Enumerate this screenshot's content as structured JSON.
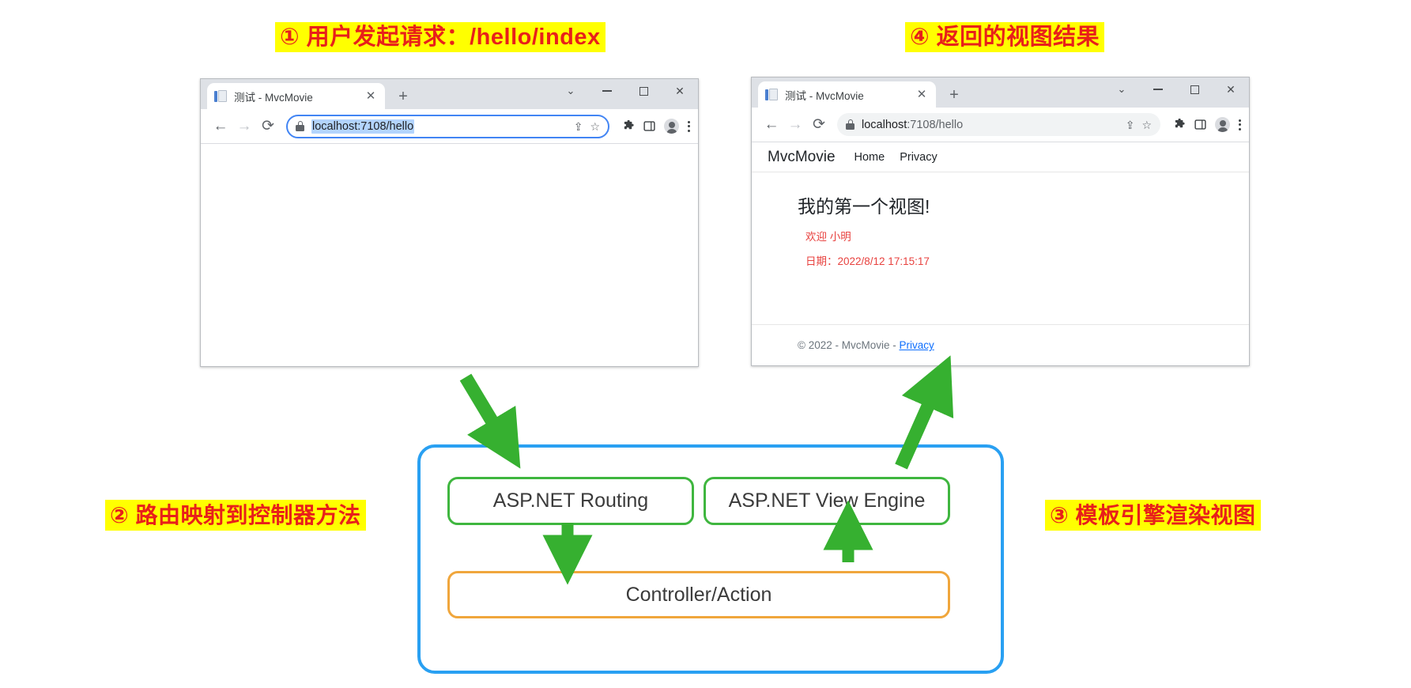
{
  "annotations": [
    {
      "id": "step1",
      "text": "① 用户发起请求：/hello/index"
    },
    {
      "id": "step2",
      "text": "② 路由映射到控制器方法"
    },
    {
      "id": "step3",
      "text": "③ 模板引擎渲染视图"
    },
    {
      "id": "step4",
      "text": "④ 返回的视图结果"
    }
  ],
  "colors": {
    "highlight_bg": "#ffff00",
    "annotation_text": "#e8201a",
    "container_border": "#29a0f2",
    "green_border": "#3fb63f",
    "orange_border": "#f0a63c",
    "arrow_green": "#36b030",
    "page_red": "#e8423f",
    "link_blue": "#0d6efd"
  },
  "browser_left": {
    "tab": {
      "title": "测试 - MvcMovie",
      "close_label": "✕",
      "favicon": "document-icon"
    },
    "new_tab_label": "+",
    "window_controls": {
      "collapse": "⌄",
      "minimize": "—",
      "maximize": "▢",
      "close": "✕"
    },
    "toolbar": {
      "back": "←",
      "forward": "→",
      "reload": "⟳",
      "share": "⇪",
      "bookmark": "☆",
      "extensions": "🧩",
      "sidepanel": "▯",
      "profile": "profile-avatar",
      "menu": "⋮"
    },
    "omnibox": {
      "url_full": "localhost:7108/hello",
      "url_host": "localhost",
      "url_path": ":7108/hello",
      "selected": true,
      "placeholder": "Search Google or type a URL"
    },
    "page": {
      "content": ""
    }
  },
  "browser_right": {
    "tab": {
      "title": "测试 - MvcMovie",
      "close_label": "✕",
      "favicon": "document-icon"
    },
    "new_tab_label": "+",
    "window_controls": {
      "collapse": "⌄",
      "minimize": "—",
      "maximize": "▢",
      "close": "✕"
    },
    "toolbar": {
      "back": "←",
      "forward": "→",
      "reload": "⟳",
      "share": "⇪",
      "bookmark": "☆",
      "extensions": "🧩",
      "sidepanel": "▯",
      "profile": "profile-avatar",
      "menu": "⋮"
    },
    "omnibox": {
      "url_full": "localhost:7108/hello",
      "url_host": "localhost",
      "url_path": ":7108/hello",
      "selected": false,
      "placeholder": "Search Google or type a URL"
    },
    "page": {
      "brand": "MvcMovie",
      "nav": [
        {
          "label": "Home"
        },
        {
          "label": "Privacy"
        }
      ],
      "heading": "我的第一个视图!",
      "welcome": "欢迎 小明",
      "date_line": "日期：2022/8/12 17:15:17",
      "footer": {
        "text": "© 2022 - MvcMovie - ",
        "link": "Privacy"
      }
    }
  },
  "diagram": {
    "boxes": [
      {
        "id": "routing",
        "label": "ASP.NET Routing"
      },
      {
        "id": "view_engine",
        "label": "ASP.NET View Engine"
      },
      {
        "id": "controller",
        "label": "Controller/Action"
      }
    ]
  }
}
